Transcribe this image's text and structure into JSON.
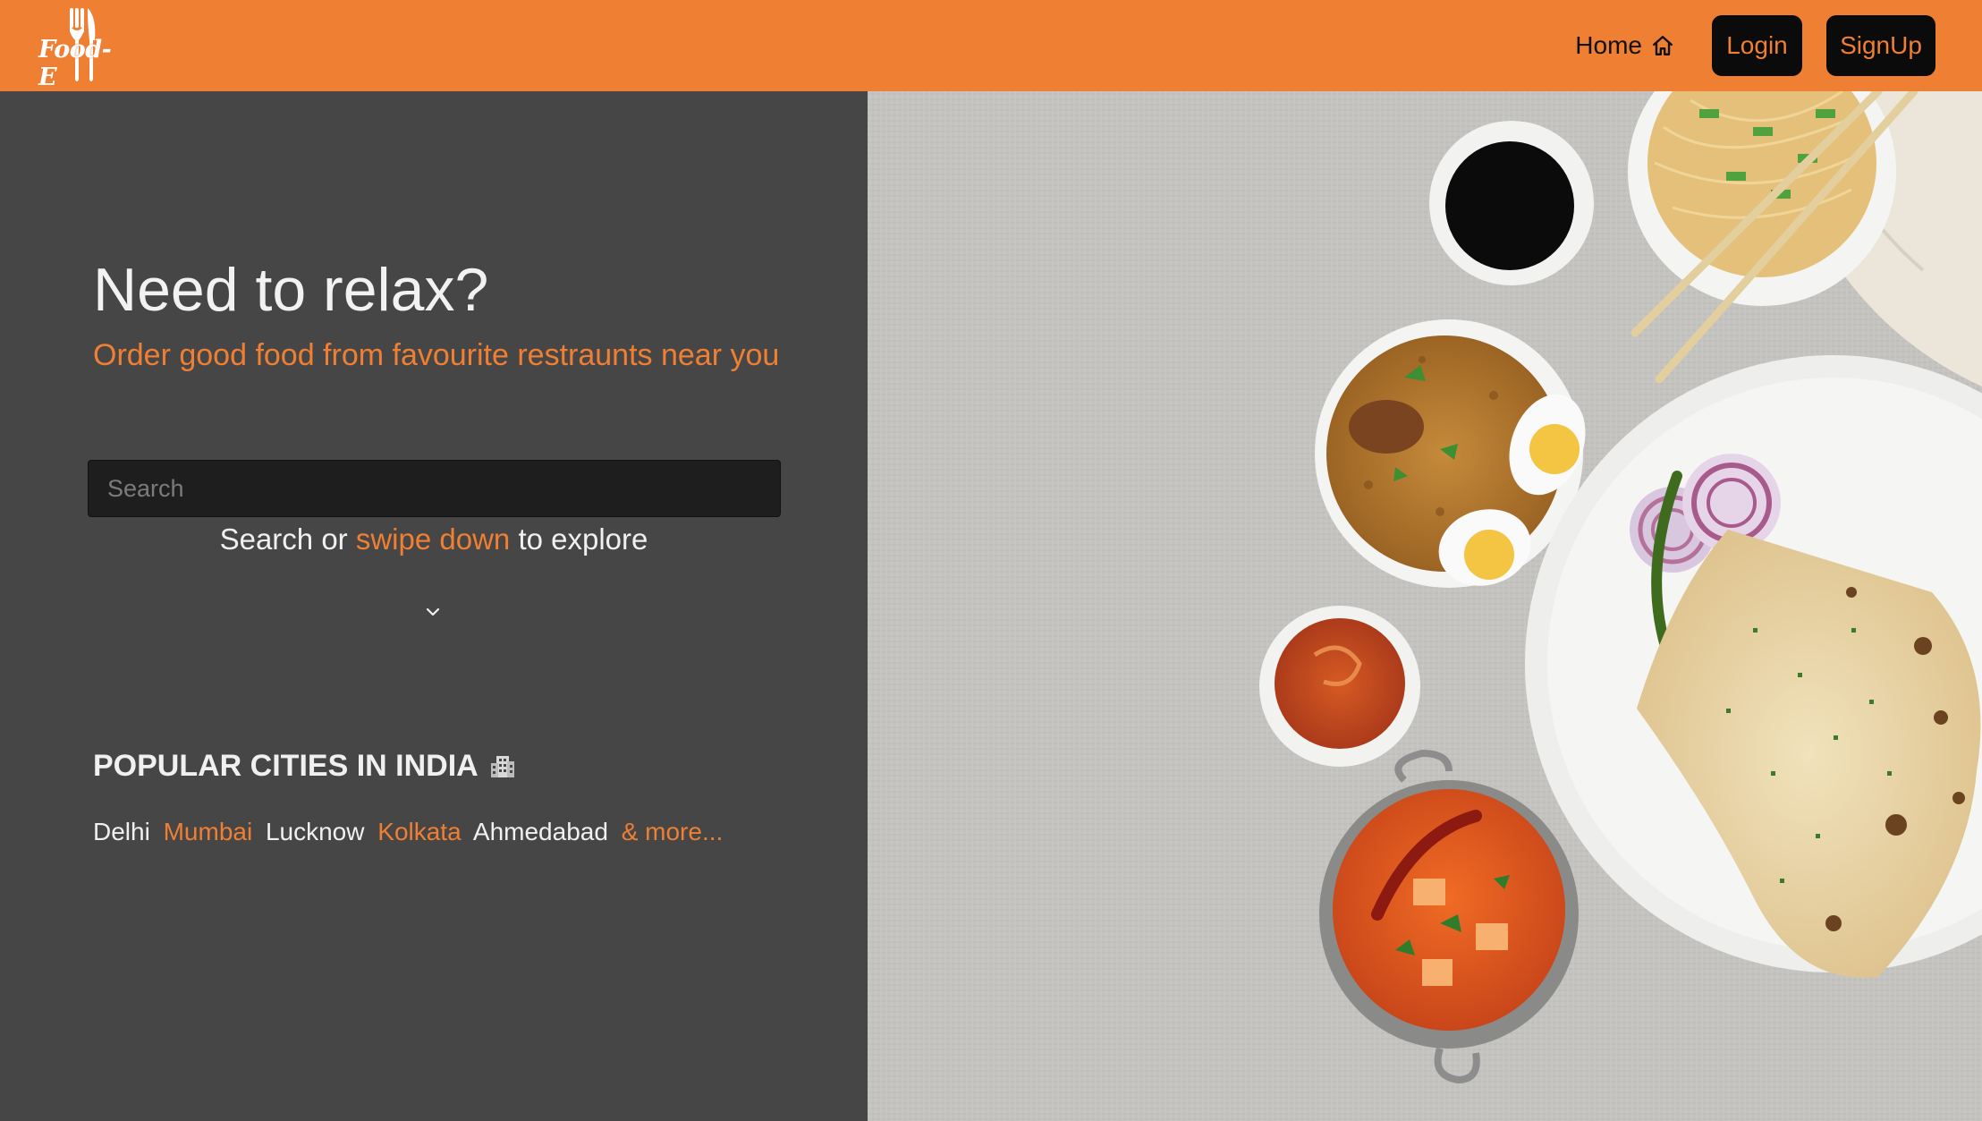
{
  "brand": {
    "logo_text": "Food-E"
  },
  "nav": {
    "home_label": "Home",
    "login_label": "Login",
    "signup_label": "SignUp"
  },
  "hero": {
    "title": "Need to relax?",
    "subtitle": "Order good food from favourite restraunts near you"
  },
  "search": {
    "placeholder": "Search",
    "value": "",
    "hint_prefix": "Search or",
    "hint_link": "swipe down",
    "hint_suffix": "to explore"
  },
  "cities": {
    "title": "POPULAR CITIES IN INDIA",
    "items": [
      {
        "label": "Delhi",
        "color": "#f0f0f0"
      },
      {
        "label": "Mumbai",
        "color": "#ef7f33"
      },
      {
        "label": "Lucknow",
        "color": "#f0f0f0"
      },
      {
        "label": "Kolkata",
        "color": "#ef7f33"
      },
      {
        "label": "Ahmedabad",
        "color": "#f0f0f0"
      }
    ],
    "more_label": "& more..."
  },
  "colors": {
    "accent": "#ef7f33",
    "panel_bg": "#464646",
    "button_bg": "#0b0b0b"
  },
  "icons": {
    "home": "home-icon",
    "chevron": "chevron-down-icon",
    "building": "building-icon"
  }
}
